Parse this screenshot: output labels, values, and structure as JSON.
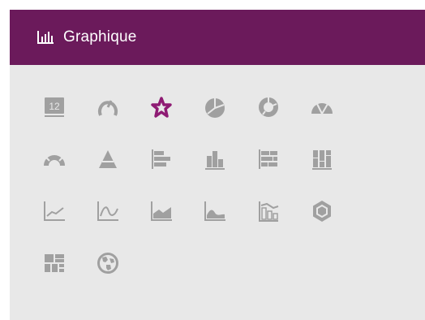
{
  "panel": {
    "title": "Graphique",
    "title_icon": "bar-chart-icon",
    "header_color": "#6b1a5b",
    "background": "#e8e8e8",
    "icon_color": "#a0a0a0",
    "selected_color": "#8e1b73"
  },
  "chart_types": [
    {
      "icon": "number-kpi-icon",
      "label": "12",
      "selected": false
    },
    {
      "icon": "gauge-icon",
      "selected": false
    },
    {
      "icon": "star-icon",
      "selected": true
    },
    {
      "icon": "pie-chart-icon",
      "selected": false
    },
    {
      "icon": "donut-chart-icon",
      "selected": false
    },
    {
      "icon": "semi-pie-icon",
      "selected": false
    },
    {
      "icon": "semi-donut-icon",
      "selected": false
    },
    {
      "icon": "pyramid-icon",
      "selected": false
    },
    {
      "icon": "horizontal-bar-icon",
      "selected": false
    },
    {
      "icon": "vertical-bar-icon",
      "selected": false
    },
    {
      "icon": "stacked-horizontal-bar-icon",
      "selected": false
    },
    {
      "icon": "stacked-vertical-bar-icon",
      "selected": false
    },
    {
      "icon": "line-chart-icon",
      "selected": false
    },
    {
      "icon": "spline-chart-icon",
      "selected": false
    },
    {
      "icon": "area-chart-icon",
      "selected": false
    },
    {
      "icon": "spline-area-icon",
      "selected": false
    },
    {
      "icon": "combo-bar-line-icon",
      "selected": false
    },
    {
      "icon": "hexagon-icon",
      "selected": false
    },
    {
      "icon": "treemap-icon",
      "selected": false
    },
    {
      "icon": "globe-map-icon",
      "selected": false
    }
  ]
}
